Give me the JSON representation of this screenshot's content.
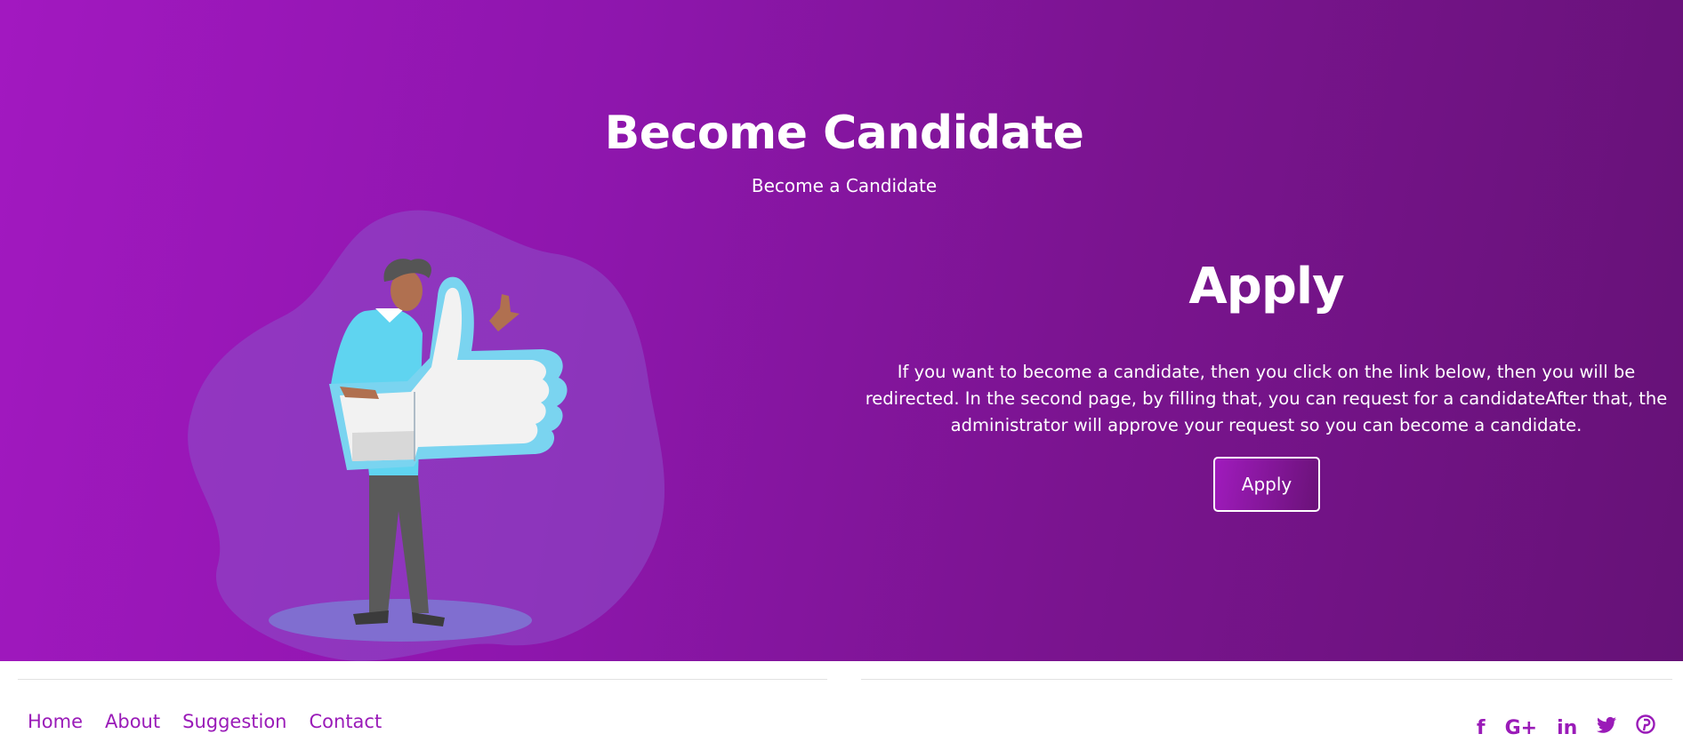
{
  "hero": {
    "title": "Become Candidate",
    "subtitle": "Become a Candidate",
    "colors": {
      "gradient_start": "#a218c0",
      "gradient_end": "#661277"
    }
  },
  "apply": {
    "title": "Apply",
    "description": "If you want to become a candidate, then you click on the link below, then you will be redirected. In the second page, by filling that, you can request for a candidateAfter that, the administrator will approve your request so you can become a candidate.",
    "button_label": "Apply"
  },
  "illustration": {
    "icon": "thumbs-up-person-illustration"
  },
  "footer": {
    "nav": [
      {
        "label": "Home"
      },
      {
        "label": "About"
      },
      {
        "label": "Suggestion"
      },
      {
        "label": "Contact"
      }
    ],
    "socials": [
      {
        "icon": "facebook-icon",
        "glyph": "f"
      },
      {
        "icon": "google-plus-icon",
        "glyph": "G+"
      },
      {
        "icon": "linkedin-icon",
        "glyph": "in"
      },
      {
        "icon": "twitter-icon",
        "glyph": "🐦"
      },
      {
        "icon": "pinterest-icon",
        "glyph": "℗"
      }
    ],
    "accent": "#9a1bb8"
  }
}
